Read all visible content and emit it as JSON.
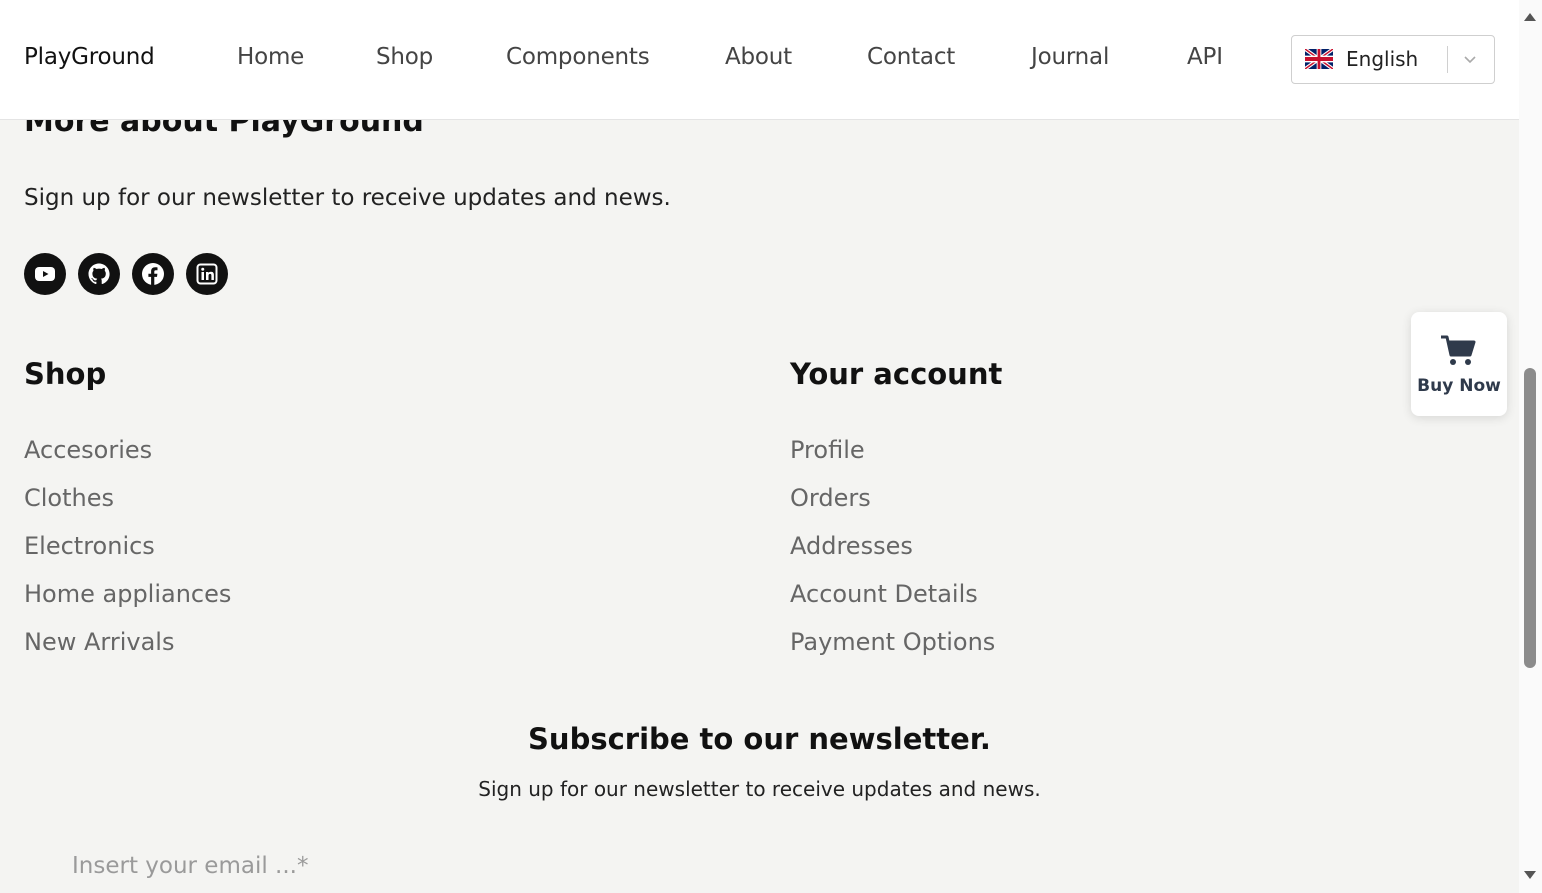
{
  "header": {
    "brand": "PlayGround",
    "nav": [
      "Home",
      "Shop",
      "Components",
      "About",
      "Contact",
      "Journal",
      "API"
    ],
    "language": "English"
  },
  "more": {
    "title": "More about PlayGround",
    "description": "Sign up for our newsletter to receive updates and news.",
    "social_icons": [
      "youtube-icon",
      "github-icon",
      "facebook-icon",
      "linkedin-icon"
    ]
  },
  "shop": {
    "title": "Shop",
    "links": [
      "Accesories",
      "Clothes",
      "Electronics",
      "Home appliances",
      "New Arrivals"
    ]
  },
  "account": {
    "title": "Your account",
    "links": [
      "Profile",
      "Orders",
      "Addresses",
      "Account Details",
      "Payment Options"
    ]
  },
  "newsletter": {
    "title": "Subscribe to our newsletter.",
    "description": "Sign up for our newsletter to receive updates and news.",
    "email_placeholder": "Insert your email ...*"
  },
  "buy_now": {
    "label": "Buy Now",
    "icon": "cart-icon"
  },
  "colors": {
    "page_bg": "#f4f4f2",
    "header_bg": "#ffffff",
    "social_bg": "#111111",
    "link_gray": "#666666",
    "buy_now_text": "#2f3a4b"
  }
}
